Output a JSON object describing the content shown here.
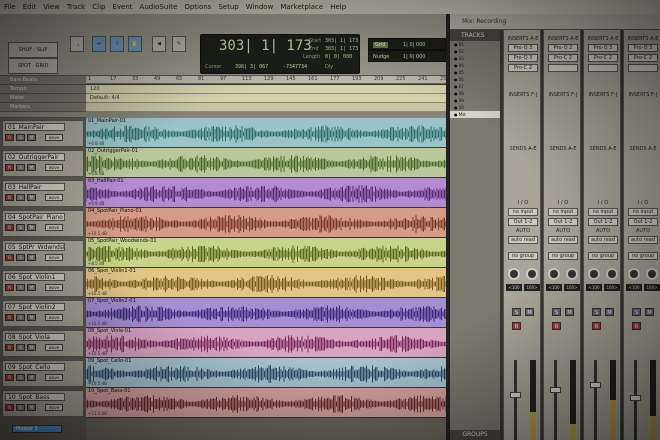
{
  "menubar": {
    "items": [
      "File",
      "Edit",
      "View",
      "Track",
      "Clip",
      "Event",
      "AudioSuite",
      "Options",
      "Setup",
      "Window",
      "Marketplace",
      "Help"
    ]
  },
  "toolbar": {
    "buttons": [
      "ZOOM",
      "TRIM",
      "SELECT",
      "GRAB",
      "SCRUB",
      "PENCIL"
    ],
    "counter_main": "303| 1| 173",
    "start_label": "Start",
    "start_value": "303| 1| 173",
    "end_label": "End",
    "end_value": "303| 1| 173",
    "length_label": "Length",
    "length_value": "0| 0| 000",
    "cursor_label": "Cursor",
    "cursor_value": "398| 3| 067",
    "sample_value": "-7347734",
    "dly_label": "Dly",
    "grid_label": "Grid",
    "grid_value": "1| 0| 000",
    "nudge_label": "Nudge",
    "nudge_value": "1| 0| 000"
  },
  "ruler": {
    "rows": [
      "Bars:Beats",
      "Tempo",
      "Meter",
      "Markers"
    ],
    "ticks": [
      "1",
      "17",
      "33",
      "49",
      "65",
      "81",
      "97",
      "113",
      "129",
      "145",
      "161",
      "177",
      "193",
      "209",
      "225",
      "241",
      "257"
    ],
    "tempo_text": "120",
    "meter_text": "Default: 4/4"
  },
  "tracks": [
    {
      "name": "01_MainPair",
      "clip": "01_MainPair-01",
      "vol": "+6.8 dB",
      "color": "#9ac4c8"
    },
    {
      "name": "02_OutriggerPair",
      "clip": "02_OutriggerPair-01",
      "vol": "+6.8 dB",
      "color": "#b9c79a"
    },
    {
      "name": "03_HallPair",
      "clip": "03_HallPair-01",
      "vol": "+6.9 dB",
      "color": "#b48bd2"
    },
    {
      "name": "04_SpotPair_Piano",
      "clip": "04_SpotPair_Piano-01",
      "vol": "+10.5 dB",
      "color": "#d49b86"
    },
    {
      "name": "05_SptPr_WdwndsL",
      "clip": "05_SpotPair_Woodwinds-01",
      "vol": "+8.5 dB",
      "color": "#c8d48c"
    },
    {
      "name": "06_Spot_Violin1",
      "clip": "06_Spot_Violin1-01",
      "vol": "+10.5 dB",
      "color": "#e3c58a"
    },
    {
      "name": "07_Spot_Violin2",
      "clip": "07_Spot_Violin2-01",
      "vol": "+10.5 dB",
      "color": "#a58fd3"
    },
    {
      "name": "08_Spot_Viola",
      "clip": "08_Spot_Viola-01",
      "vol": "+10.5 dB",
      "color": "#d7a4c2"
    },
    {
      "name": "09_Spot_Cello",
      "clip": "09_Spot_Cello-01",
      "vol": "+10.5 dB",
      "color": "#a6c3cf"
    },
    {
      "name": "10_Spot_Bass",
      "clip": "10_Spot_Bass-01",
      "vol": "+11.5 dB",
      "color": "#d7a3a3"
    }
  ],
  "master": {
    "label": "Master 1"
  },
  "track_controls": {
    "solo": "S",
    "mute": "M",
    "rec": "R",
    "wave": "wave"
  },
  "tracks_panel": {
    "header": "TRACKS",
    "rows": [
      "01",
      "02",
      "03",
      "04",
      "05",
      "06",
      "07",
      "08",
      "09",
      "10",
      "Mst"
    ],
    "groups": "GROUPS"
  },
  "mix_window_title": "Mix: Recording",
  "mixer": {
    "inserts_ae": "INSERTS A-E",
    "inserts_fj": "INSERTS F-J",
    "sends_ae": "SENDS A-E",
    "io": "I / O",
    "input": "no input",
    "output": "Out 1-2",
    "auto_label": "AUTO",
    "auto_value": "auto read",
    "group": "no group",
    "strips": [
      {
        "inserts": [
          "Pro-Q 3",
          "Pro-Q 3",
          "Pro-C 2"
        ],
        "pan_l": "<100",
        "pan_r": "100>",
        "fader": 0.55,
        "meter": 0.35
      },
      {
        "inserts": [
          "Pro-Q 2",
          "Pro-C 2",
          ""
        ],
        "pan_l": "<100",
        "pan_r": "100>",
        "fader": 0.62,
        "meter": 0.2
      },
      {
        "inserts": [
          "Pro-Q 3",
          "Pro-C 2",
          ""
        ],
        "pan_l": "<100",
        "pan_r": "100>",
        "fader": 0.68,
        "meter": 0.5
      },
      {
        "inserts": [
          "Pro-Q 3",
          "Pro-C 2",
          ""
        ],
        "pan_l": "<100",
        "pan_r": "100>",
        "fader": 0.5,
        "meter": 0.3
      }
    ]
  }
}
